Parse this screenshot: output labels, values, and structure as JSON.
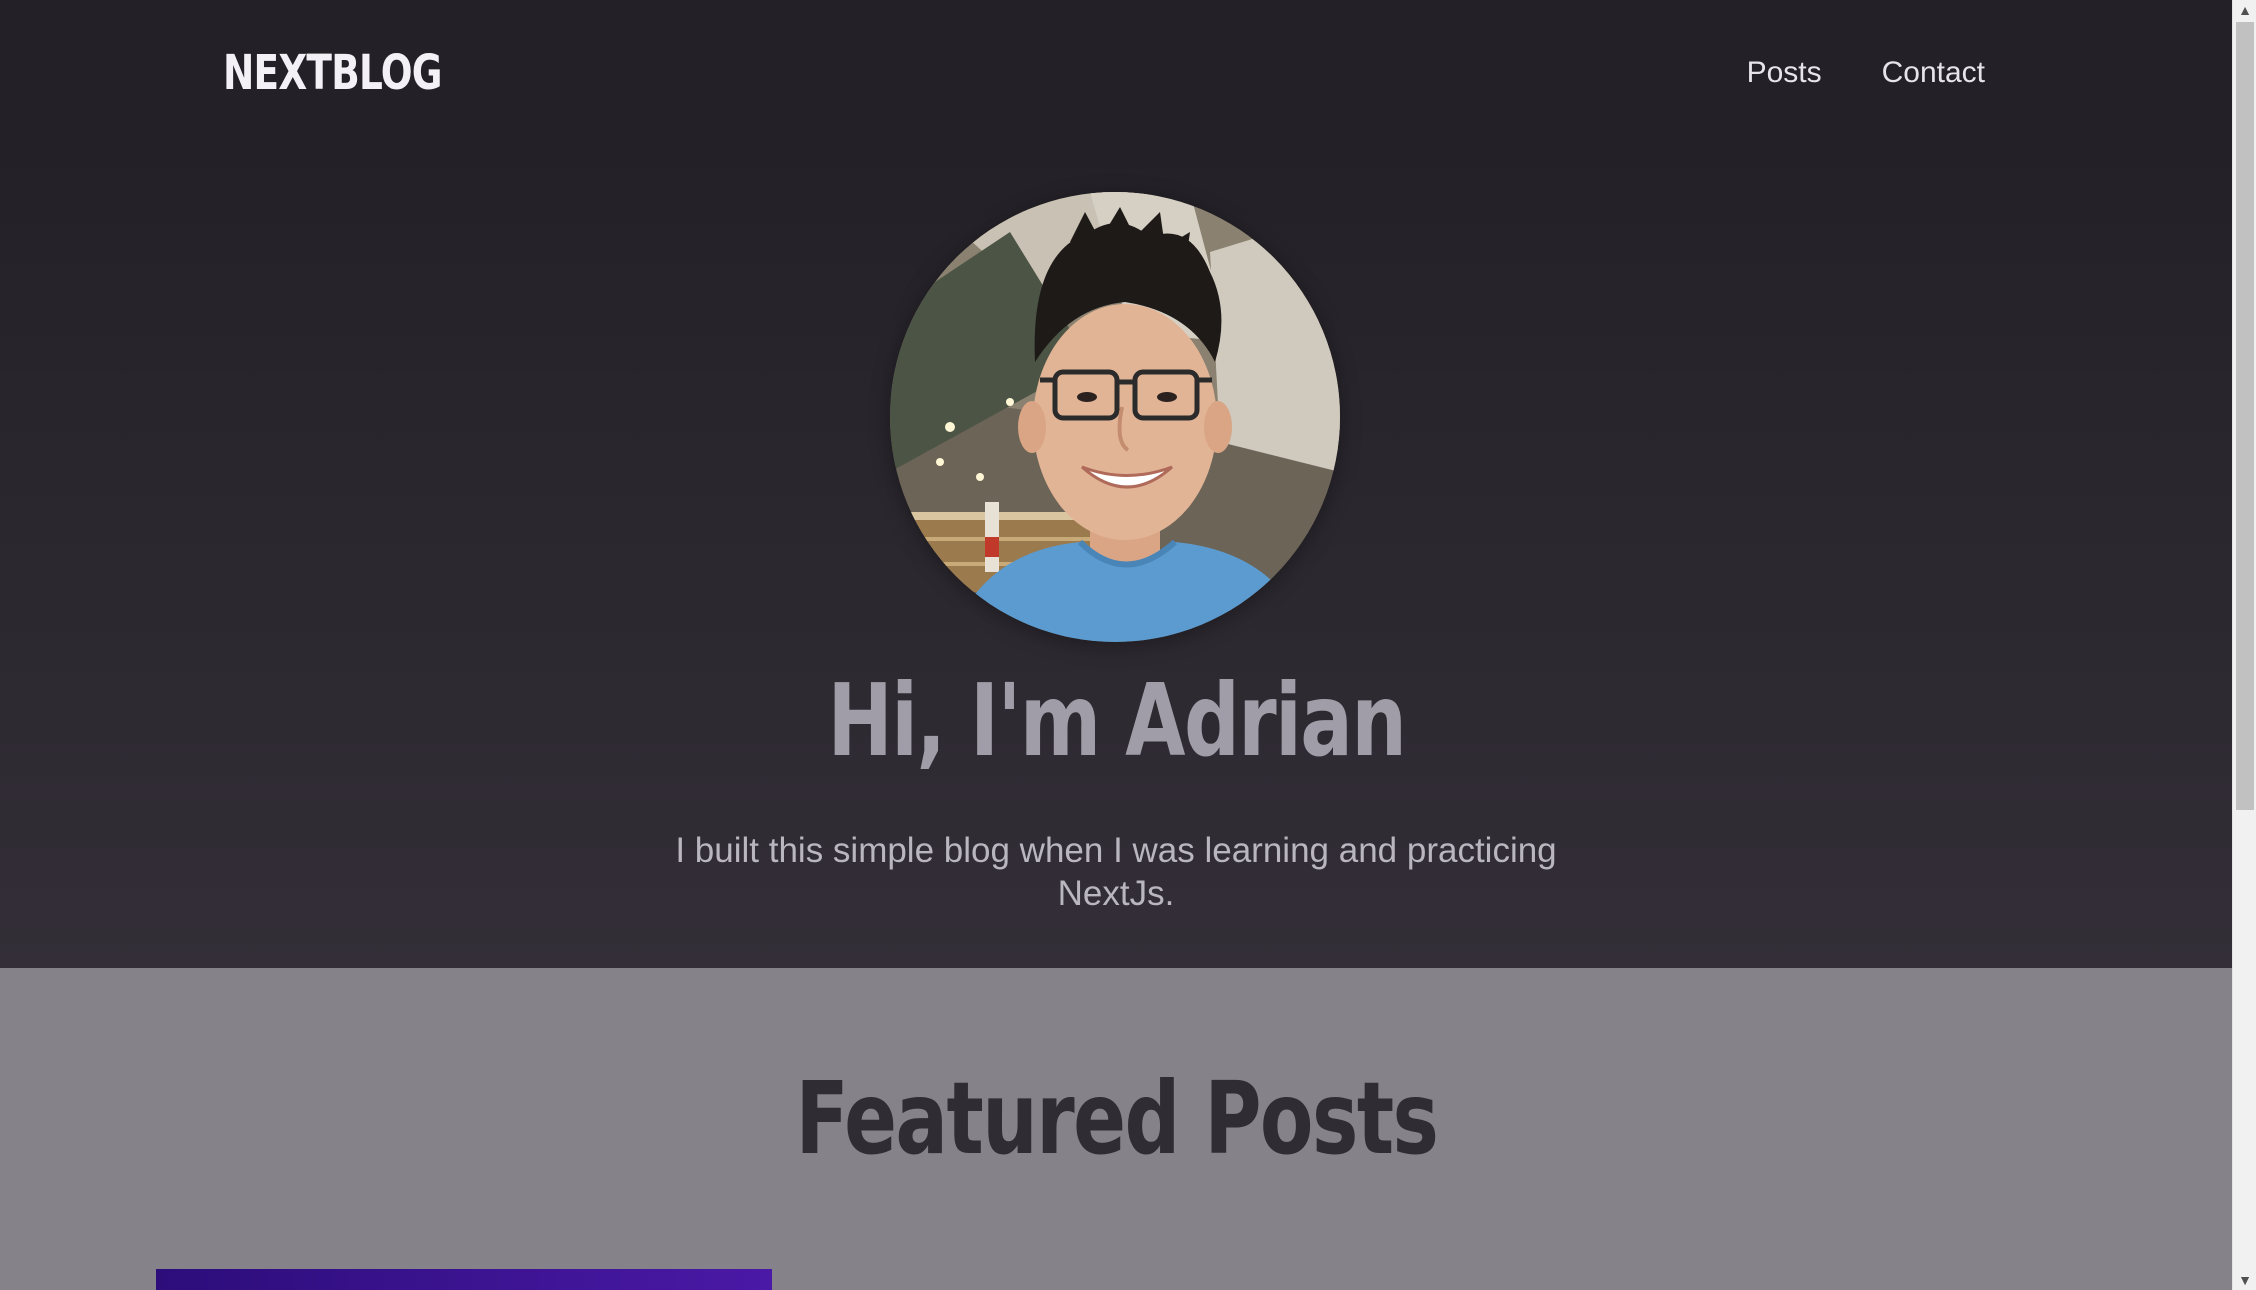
{
  "header": {
    "logo": "NEXTBLOG",
    "nav": [
      {
        "label": "Posts"
      },
      {
        "label": "Contact"
      }
    ]
  },
  "hero": {
    "avatar_alt": "Adrian profile photo",
    "title": "Hi, I'm Adrian",
    "subtitle": "I built this simple blog when I was learning and practicing NextJs."
  },
  "featured": {
    "title": "Featured Posts"
  },
  "colors": {
    "header_bg": "#232127",
    "hero_bg_end": "#332e37",
    "featured_bg": "#858289",
    "post_card_accent": "#3a1296"
  },
  "scrollbar": {
    "up_icon": "triangle-up-icon",
    "down_icon": "triangle-down-icon"
  }
}
